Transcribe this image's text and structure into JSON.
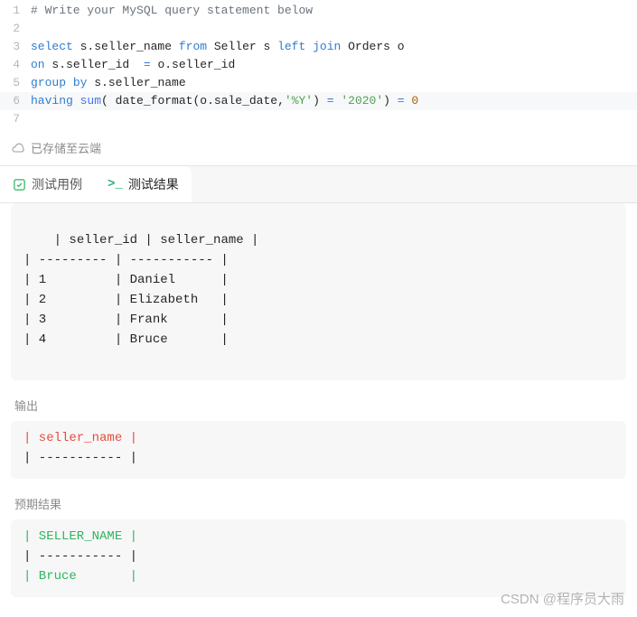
{
  "editor": {
    "lines": [
      {
        "n": 1,
        "tokens": [
          [
            "c-comment",
            "# Write your MySQL query statement below"
          ]
        ]
      },
      {
        "n": 2,
        "tokens": [
          [
            "c-plain",
            ""
          ]
        ]
      },
      {
        "n": 3,
        "tokens": [
          [
            "c-kw",
            "select"
          ],
          [
            "c-plain",
            " s.seller_name "
          ],
          [
            "c-kw",
            "from"
          ],
          [
            "c-plain",
            " Seller s "
          ],
          [
            "c-kw",
            "left"
          ],
          [
            "c-plain",
            " "
          ],
          [
            "c-kw",
            "join"
          ],
          [
            "c-plain",
            " Orders o"
          ]
        ]
      },
      {
        "n": 4,
        "tokens": [
          [
            "c-kw",
            "on"
          ],
          [
            "c-plain",
            " s.seller_id  "
          ],
          [
            "c-kw",
            "="
          ],
          [
            "c-plain",
            " o.seller_id"
          ]
        ]
      },
      {
        "n": 5,
        "tokens": [
          [
            "c-kw",
            "group"
          ],
          [
            "c-plain",
            " "
          ],
          [
            "c-kw",
            "by"
          ],
          [
            "c-plain",
            " s.seller_name"
          ]
        ]
      },
      {
        "n": 6,
        "tokens": [
          [
            "c-kw",
            "having"
          ],
          [
            "c-plain",
            " "
          ],
          [
            "c-func",
            "sum"
          ],
          [
            "c-plain",
            "( "
          ],
          [
            "c-plain",
            "date_format"
          ],
          [
            "c-plain",
            "(o.sale_date,"
          ],
          [
            "c-str",
            "'%Y'"
          ],
          [
            "c-plain",
            ") "
          ],
          [
            "c-kw",
            "="
          ],
          [
            "c-plain",
            " "
          ],
          [
            "c-str",
            "'2020'"
          ],
          [
            "c-plain",
            ") "
          ],
          [
            "c-kw",
            "="
          ],
          [
            "c-plain",
            " "
          ],
          [
            "c-num",
            "0"
          ]
        ]
      },
      {
        "n": 7,
        "tokens": [
          [
            "c-plain",
            ""
          ]
        ]
      }
    ],
    "cursor_line": 6
  },
  "saved_text": "已存储至云端",
  "tabs": {
    "test_cases_label": "测试用例",
    "test_results_label": "测试结果"
  },
  "results": {
    "input_block": "| seller_id | seller_name |\n| --------- | ----------- |\n| 1         | Daniel      |\n| 2         | Elizabeth   |\n| 3         | Frank       |\n| 4         | Bruce       |",
    "output_label": "输出",
    "output_rows": [
      {
        "cls": "txt-red",
        "text": "| seller_name |"
      },
      {
        "cls": "",
        "text": "| ----------- |"
      }
    ],
    "expected_label": "预期结果",
    "expected_rows": [
      {
        "cls": "txt-green",
        "text": "| SELLER_NAME |"
      },
      {
        "cls": "",
        "text": "| ----------- |"
      },
      {
        "cls": "txt-green",
        "text": "| Bruce       |"
      }
    ]
  },
  "watermark": "CSDN @程序员大雨"
}
